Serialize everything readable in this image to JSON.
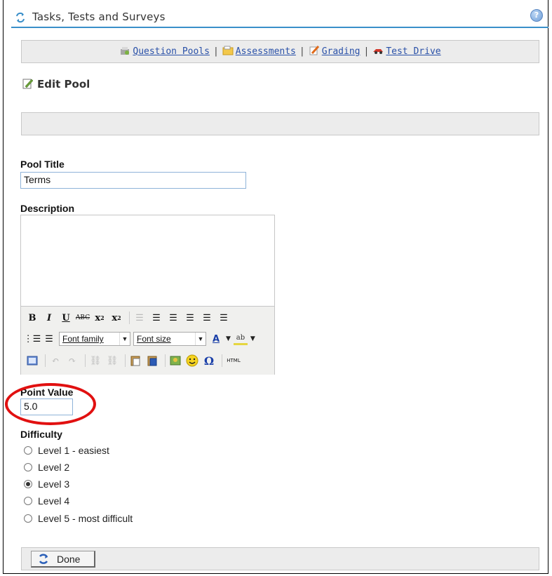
{
  "header": {
    "title": "Tasks, Tests and Surveys"
  },
  "nav": {
    "question_pools": "Question Pools",
    "assessments": "Assessments",
    "grading": "Grading",
    "test_drive": "Test Drive",
    "separator": "|"
  },
  "page": {
    "title": "Edit Pool"
  },
  "form": {
    "pool_title_label": "Pool Title",
    "pool_title_value": "Terms",
    "description_label": "Description",
    "point_value_label": "Point Value",
    "point_value": "5.0",
    "difficulty_label": "Difficulty",
    "difficulty_options": [
      "Level 1 - easiest",
      "Level 2",
      "Level 3",
      "Level 4",
      "Level 5 - most difficult"
    ],
    "difficulty_selected": "Level 3"
  },
  "editor": {
    "font_family": "Font family",
    "font_size": "Font size",
    "html_label": "HTML"
  },
  "footer": {
    "done_label": "Done"
  },
  "colors": {
    "accent": "#3a8fc9",
    "link": "#2a51a8",
    "highlight": "#e11010"
  }
}
